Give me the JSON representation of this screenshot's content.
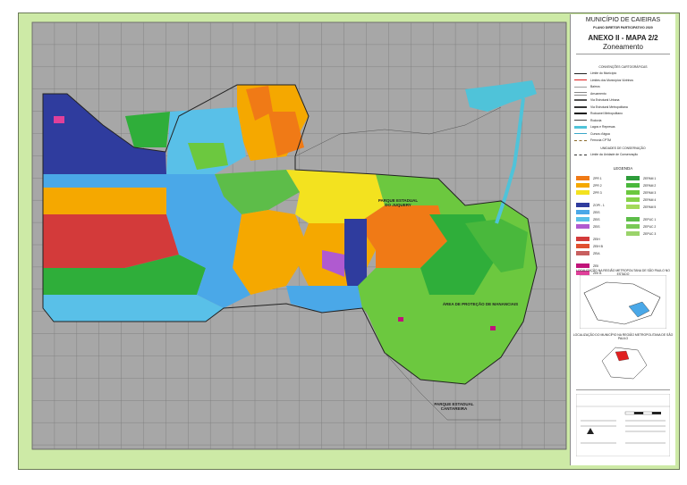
{
  "title": {
    "municipality": "MUNICÍPIO DE CAIEIRAS",
    "plan": "PLANO DIRETOR PARTICIPATIVO 2020",
    "annex": "ANEXO II - MAPA 2/2",
    "subject": "Zoneamento"
  },
  "conventions": {
    "heading": "CONVENÇÕES CARTOGRÁFICAS",
    "items": [
      {
        "label": "Limite do Município",
        "color": "#222222",
        "style": "solid"
      },
      {
        "label": "Limites dos Municípios Vizinhos",
        "color": "#e02020",
        "style": "solid"
      },
      {
        "label": "Bairros",
        "color": "#9a9a9a",
        "style": "thin"
      },
      {
        "label": "Arruamento",
        "color": "#888888",
        "style": "double"
      },
      {
        "label": "Via Estrutural Urbana",
        "color": "#555555",
        "style": "thick"
      },
      {
        "label": "Via Estrutural Metropolitana",
        "color": "#333333",
        "style": "thick"
      },
      {
        "label": "Rodoanel Metropolitano",
        "color": "#111111",
        "style": "thick"
      },
      {
        "label": "Rodovia",
        "color": "#444444",
        "style": "solid"
      },
      {
        "label": "Lagos e Represas",
        "color": "#4fc3d9",
        "style": "fill"
      },
      {
        "label": "Cursos d'água",
        "color": "#3aa7c9",
        "style": "solid"
      },
      {
        "label": "Ferrovia CPTM",
        "color": "#8a6a2a",
        "style": "dashed"
      }
    ],
    "uc_heading": "UNIDADES DE CONSERVAÇÃO",
    "uc_item": "Limite da Unidade de Conservação"
  },
  "legend": {
    "heading": "LEGENDA",
    "left": [
      {
        "code": "ZPR 1",
        "color": "#f07a16"
      },
      {
        "code": "ZPR 2",
        "color": "#f5a800"
      },
      {
        "code": "ZPR 3",
        "color": "#f3e21f"
      },
      {
        "code": "ZOPI - 1",
        "color": "#2f3c9e"
      },
      {
        "code": "ZEIS",
        "color": "#4aa8e8"
      },
      {
        "code": "ZEIS",
        "color": "#59c0e8"
      },
      {
        "code": "ZEIS",
        "color": "#b05ad0"
      },
      {
        "code": "ZEIH",
        "color": "#d33a3a"
      },
      {
        "code": "ZEIH B",
        "color": "#e05030"
      },
      {
        "code": "ZEIA",
        "color": "#c85f5f"
      },
      {
        "code": "ZEII",
        "color": "#c0147a"
      },
      {
        "code": "ZEII B",
        "color": "#e0409a"
      }
    ],
    "right": [
      {
        "code": "ZEPAM 1",
        "color": "#2d9c3a"
      },
      {
        "code": "ZEPAM 2",
        "color": "#49b83c"
      },
      {
        "code": "ZEPAM 3",
        "color": "#6cc83f"
      },
      {
        "code": "ZEPAM 4",
        "color": "#86d249"
      },
      {
        "code": "ZEPAM 5",
        "color": "#a3d95a"
      },
      {
        "code": "ZEPUC 1",
        "color": "#5dbd49"
      },
      {
        "code": "ZEPUC 2",
        "color": "#79c955"
      },
      {
        "code": "ZEPUC 3",
        "color": "#9ad36a"
      }
    ]
  },
  "location": {
    "heading": "LOCALIZAÇÃO NA REGIÃO METROPOLITANA DE SÃO PAULO NO ESTADO",
    "note": "LOCALIZAÇÃO DO MUNICÍPIO NA REGIÃO METROPOLITANA DE SÃO PAULO"
  },
  "map_labels": {
    "park_juquery": "PARQUE ESTADUAL\nDO JUQUERY",
    "apm": "ÁREA DE PROTEÇÃO DE MANANCIAIS",
    "park_cantareira": "PARQUE ESTADUAL\nCANTAREIRA"
  },
  "colors": {
    "background": "#cdeaa6",
    "map_gray": "#a7a7a7",
    "grid": "#7a7a7a"
  }
}
